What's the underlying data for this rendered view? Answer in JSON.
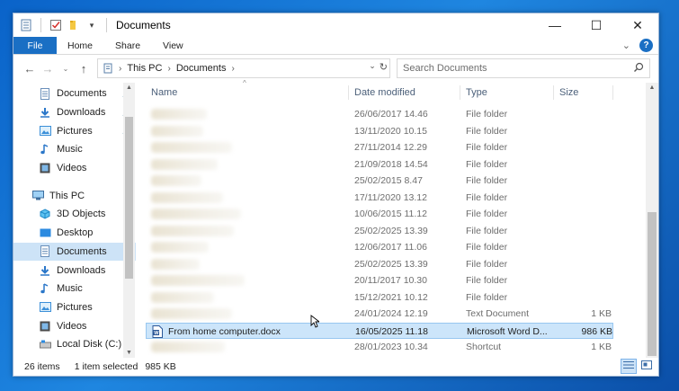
{
  "window": {
    "title": "Documents",
    "controls": {
      "minimize": "—",
      "maximize": "☐",
      "close": "✕"
    }
  },
  "ribbon": {
    "tabs": [
      "File",
      "Home",
      "Share",
      "View"
    ]
  },
  "address": {
    "path": [
      "This PC",
      "Documents"
    ],
    "search_placeholder": "Search Documents"
  },
  "nav": {
    "quick_access": [
      {
        "label": "Documents",
        "icon": "documents-icon",
        "pinned": true
      },
      {
        "label": "Downloads",
        "icon": "downloads-icon",
        "pinned": true
      },
      {
        "label": "Pictures",
        "icon": "pictures-icon",
        "pinned": true
      },
      {
        "label": "Music",
        "icon": "music-icon",
        "pinned": false
      },
      {
        "label": "Videos",
        "icon": "videos-icon",
        "pinned": false
      }
    ],
    "this_pc": {
      "label": "This PC",
      "icon": "pc-icon"
    },
    "pc_items": [
      {
        "label": "3D Objects",
        "icon": "3d-objects-icon"
      },
      {
        "label": "Desktop",
        "icon": "desktop-icon"
      },
      {
        "label": "Documents",
        "icon": "documents-icon",
        "selected": true
      },
      {
        "label": "Downloads",
        "icon": "downloads-icon"
      },
      {
        "label": "Music",
        "icon": "music-icon"
      },
      {
        "label": "Pictures",
        "icon": "pictures-icon"
      },
      {
        "label": "Videos",
        "icon": "videos-icon"
      },
      {
        "label": "Local Disk (C:)",
        "icon": "drive-icon"
      }
    ]
  },
  "columns": {
    "name": "Name",
    "date": "Date modified",
    "type": "Type",
    "size": "Size"
  },
  "files": [
    {
      "name": "",
      "date": "26/06/2017 14.46",
      "type": "File folder",
      "size": ""
    },
    {
      "name": "",
      "date": "13/11/2020 10.15",
      "type": "File folder",
      "size": ""
    },
    {
      "name": "",
      "date": "27/11/2014 12.29",
      "type": "File folder",
      "size": ""
    },
    {
      "name": "",
      "date": "21/09/2018 14.54",
      "type": "File folder",
      "size": ""
    },
    {
      "name": "",
      "date": "25/02/2015 8.47",
      "type": "File folder",
      "size": ""
    },
    {
      "name": "",
      "date": "17/11/2020 13.12",
      "type": "File folder",
      "size": ""
    },
    {
      "name": "",
      "date": "10/06/2015 11.12",
      "type": "File folder",
      "size": ""
    },
    {
      "name": "",
      "date": "25/02/2025 13.39",
      "type": "File folder",
      "size": ""
    },
    {
      "name": "",
      "date": "12/06/2017 11.06",
      "type": "File folder",
      "size": ""
    },
    {
      "name": "",
      "date": "25/02/2025 13.39",
      "type": "File folder",
      "size": ""
    },
    {
      "name": "",
      "date": "20/11/2017 10.30",
      "type": "File folder",
      "size": ""
    },
    {
      "name": "",
      "date": "15/12/2021 10.12",
      "type": "File folder",
      "size": ""
    },
    {
      "name": "",
      "date": "24/01/2024 12.19",
      "type": "Text Document",
      "size": "1 KB"
    },
    {
      "name": "From home computer.docx",
      "date": "16/05/2025 11.18",
      "type": "Microsoft Word D...",
      "size": "986 KB",
      "selected": true
    },
    {
      "name": "",
      "date": "28/01/2023 10.34",
      "type": "Shortcut",
      "size": "1 KB"
    }
  ],
  "status": {
    "item_count": "26 items",
    "selection": "1 item selected",
    "selection_size": "985 KB"
  },
  "colors": {
    "accent": "#1a6fc4",
    "selected_bg": "#cce5fa",
    "selected_border": "#98c7f0",
    "nav_selected": "#cde3f7"
  }
}
